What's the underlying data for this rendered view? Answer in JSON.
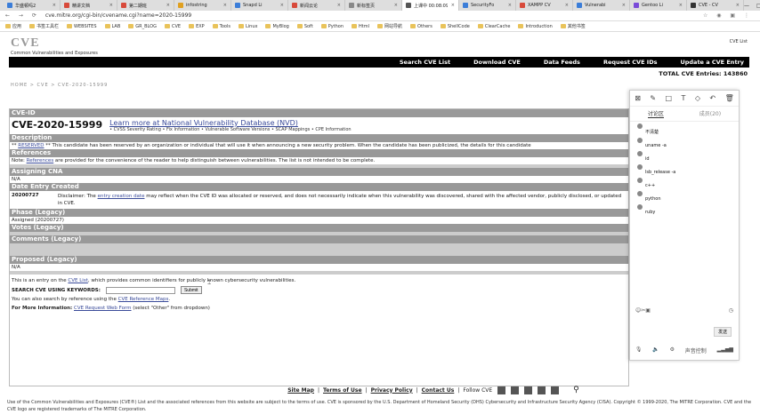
{
  "browser": {
    "tabs": [
      {
        "label": "华盛顿吗2",
        "color": "#3b7dd8"
      },
      {
        "label": "精讲文档",
        "color": "#d84a3b"
      },
      {
        "label": "第二期班",
        "color": "#d84a3b"
      },
      {
        "label": "infostring",
        "color": "#e0a020"
      },
      {
        "label": "Snapd Li",
        "color": "#3b7dd8"
      },
      {
        "label": "新闻云论",
        "color": "#d84a3b"
      },
      {
        "label": "新标签页",
        "color": "#888888"
      },
      {
        "label": "上课中 00:08:09",
        "color": "#555555",
        "active": true
      },
      {
        "label": "SecurityFo",
        "color": "#3b7dd8"
      },
      {
        "label": "XAMPP CV",
        "color": "#d84a3b"
      },
      {
        "label": "Vulnerabi",
        "color": "#3b7dd8"
      },
      {
        "label": "Gentoo Li",
        "color": "#7a4bd8"
      },
      {
        "label": "CVE - CV",
        "color": "#333333"
      }
    ],
    "url": "cve.mitre.org/cgi-bin/cvename.cgi?name=2020-15999",
    "bookmarks": [
      "应用",
      "书签工具栏",
      "WEBSITES",
      "LAB",
      "GR_BLOG",
      "CVE",
      "EXP",
      "Tools",
      "Linux",
      "MyBlog",
      "Soft",
      "Python",
      "Html",
      "网站导航",
      "Others",
      "ShellCode",
      "ClearCache",
      "Introduction",
      "其他书签"
    ]
  },
  "site": {
    "logo": "CVE",
    "tagline": "Common Vulnerabilities and Exposures",
    "mitre_link": "CVE List",
    "nav": [
      "Search CVE List",
      "Download CVE",
      "Data Feeds",
      "Request CVE IDs",
      "Update a CVE Entry"
    ],
    "total": "TOTAL CVE Entries: 143860",
    "breadcrumb": "HOME > CVE > CVE-2020-15999"
  },
  "cve": {
    "id_heading": "CVE-ID",
    "id": "CVE-2020-15999",
    "nvd_link": "Learn more at National Vulnerability Database (NVD)",
    "nvd_bullets": "• CVSS Severity Rating • Fix Information • Vulnerable Software Versions • SCAP Mappings • CPE Information",
    "description_heading": "Description",
    "description_prefix": "** ",
    "description_reserved": "RESERVED",
    "description_text": " ** This candidate has been reserved by an organization or individual that will use it when announcing a new security problem. When the candidate has been publicized, the details for this candidate",
    "references_heading": "References",
    "references_prefix": "Note: ",
    "references_link": "References",
    "references_text": " are provided for the convenience of the reader to help distinguish between vulnerabilities. The list is not intended to be complete.",
    "cna_heading": "Assigning CNA",
    "cna_value": "N/A",
    "date_heading": "Date Entry Created",
    "date_value": "20200727",
    "disclaimer_prefix": "Disclaimer: The ",
    "disclaimer_link": "entry creation date",
    "disclaimer_text": " may reflect when the CVE ID was allocated or reserved, and does not necessarily indicate when this vulnerability was discovered, shared with the affected vendor, publicly disclosed, or updated in CVE.",
    "phase_heading": "Phase (Legacy)",
    "phase_value": "Assigned (20200727)",
    "votes_heading": "Votes (Legacy)",
    "comments_heading": "Comments (Legacy)",
    "proposed_heading": "Proposed (Legacy)",
    "proposed_value": "N/A",
    "entry_note_prefix": "This is an entry on the ",
    "entry_note_link": "CVE List",
    "entry_note_text": ", which provides common identifiers for publicly known cybersecurity vulnerabilities.",
    "search_label": "SEARCH CVE USING KEYWORDS:",
    "search_value": "",
    "submit": "Submit",
    "ref_search_prefix": "You can also search by reference using the ",
    "ref_search_link": "CVE Reference Maps",
    "ref_search_suffix": ".",
    "more_info_label": "For More Information:",
    "more_info_link": "CVE Request Web Form",
    "more_info_text": "(select \"Other\" from dropdown)"
  },
  "footer": {
    "links": [
      "Site Map",
      "Terms of Use",
      "Privacy Policy",
      "Contact Us"
    ],
    "follow": "Follow CVE",
    "legal": "Use of the Common Vulnerabilities and Exposures (CVE®) List and the associated references from this website are subject to the terms of use. CVE is sponsored by the U.S. Department of Homeland Security (DHS) Cybersecurity and Infrastructure Security Agency (CISA). Copyright © 1999-2020, The MITRE Corporation. CVE and the CVE logo are registered trademarks of The MITRE Corporation."
  },
  "panel": {
    "tab_discussion": "讨论区",
    "tab_members": "成员(20)",
    "messages": [
      {
        "who": "",
        "text": "不清楚"
      },
      {
        "who": "",
        "text": "uname -a"
      },
      {
        "who": "",
        "text": "id"
      },
      {
        "who": "",
        "text": "lsb_release -a"
      },
      {
        "who": "",
        "text": "c++"
      },
      {
        "who": "",
        "text": "python"
      },
      {
        "who": "",
        "text": "ruby"
      }
    ],
    "send": "发送",
    "bottom_label": "声音控制"
  }
}
